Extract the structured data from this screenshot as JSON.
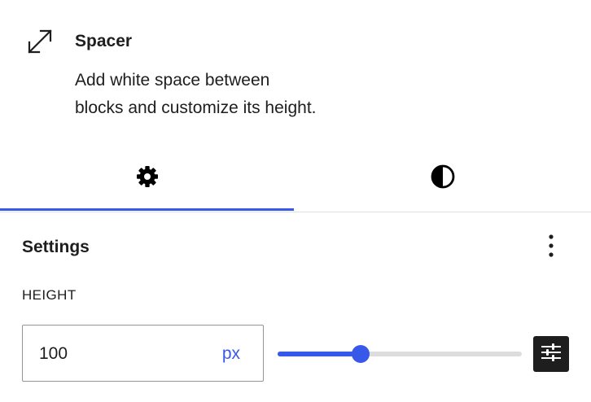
{
  "block": {
    "icon": "resize-diagonal-arrows-icon",
    "title": "Spacer",
    "description_line1": "Add white space between",
    "description_line2": "blocks and customize its height."
  },
  "tabs": [
    {
      "name": "settings",
      "icon": "gear-icon",
      "active": true
    },
    {
      "name": "styles",
      "icon": "half-circle-contrast-icon",
      "active": false
    }
  ],
  "panel": {
    "title": "Settings",
    "more_icon": "vertical-ellipsis-icon"
  },
  "height": {
    "label": "HEIGHT",
    "value": "100",
    "unit": "px",
    "slider_fraction": 0.34
  },
  "colors": {
    "accent": "#3858e9",
    "text": "#1e1e1e",
    "border": "#949494"
  }
}
